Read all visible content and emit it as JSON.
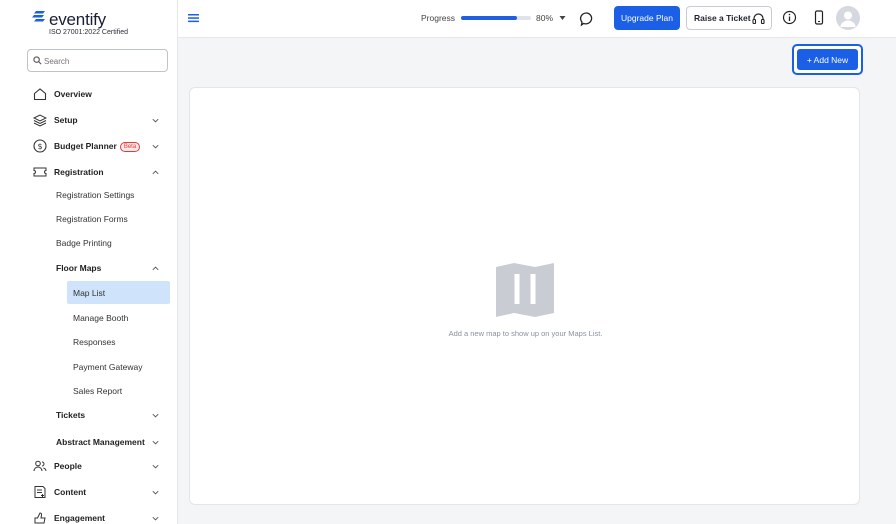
{
  "brand": {
    "name": "eventify",
    "certification": "ISO 27001:2022 Certified"
  },
  "search": {
    "placeholder": "Search"
  },
  "sidebar": {
    "overview": "Overview",
    "setup": "Setup",
    "budget_planner": "Budget Planner",
    "beta_badge": "Beta",
    "registration": "Registration",
    "registration_settings": "Registration Settings",
    "registration_forms": "Registration Forms",
    "badge_printing": "Badge Printing",
    "floor_maps": "Floor Maps",
    "map_list": "Map List",
    "manage_booth": "Manage Booth",
    "responses": "Responses",
    "payment_gateway": "Payment Gateway",
    "sales_report": "Sales Report",
    "tickets": "Tickets",
    "abstract_management": "Abstract Management",
    "people": "People",
    "content": "Content",
    "engagement": "Engagement"
  },
  "topbar": {
    "progress_label": "Progress",
    "progress_value": "80%",
    "progress_fraction": 0.8,
    "upgrade_label": "Upgrade Plan",
    "ticket_label": "Raise a Ticket"
  },
  "main": {
    "add_new_label": "+ Add New",
    "empty_message": "Add a new map to show up on your Maps List."
  },
  "colors": {
    "accent": "#1a5fe6",
    "active_item_bg": "#cfe3fb",
    "beta": "#e23b3b"
  },
  "icons": [
    "menu-icon",
    "search-icon",
    "home-icon",
    "layers-icon",
    "dollar-icon",
    "ticket-icon",
    "people-icon",
    "content-icon",
    "engagement-icon",
    "chat-icon",
    "headset-icon",
    "info-icon",
    "phone-icon",
    "avatar-icon",
    "map-icon"
  ]
}
